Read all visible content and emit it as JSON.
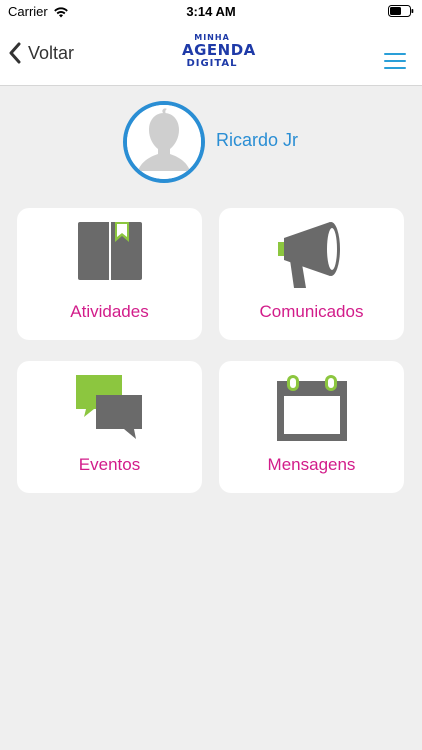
{
  "status_bar": {
    "carrier": "Carrier",
    "time": "3:14 AM"
  },
  "nav": {
    "back_label": "Voltar",
    "logo": {
      "line1": "MINHA",
      "line2": "AGENDA",
      "line3": "DIGITAL"
    }
  },
  "profile": {
    "name": "Ricardo Jr"
  },
  "cards": [
    {
      "label": "Atividades",
      "icon": "book-icon"
    },
    {
      "label": "Comunicados",
      "icon": "megaphone-icon"
    },
    {
      "label": "Eventos",
      "icon": "chat-bubbles-icon"
    },
    {
      "label": "Mensagens",
      "icon": "calendar-icon"
    }
  ],
  "colors": {
    "accent_blue": "#2a8ed4",
    "label_magenta": "#d21c8a",
    "icon_gray": "#6a6a6a",
    "icon_green": "#8cc63f",
    "background": "#efefef"
  }
}
